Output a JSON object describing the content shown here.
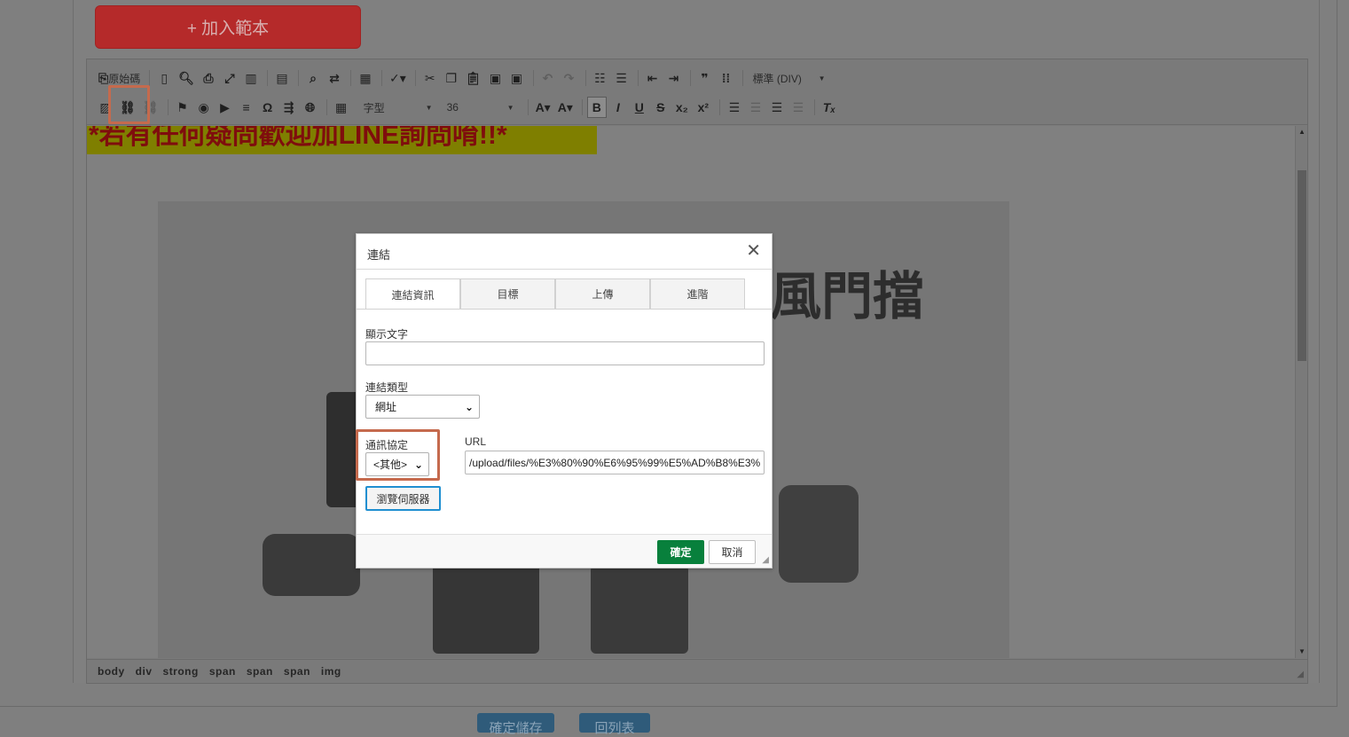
{
  "page": {
    "add_template_label": "+ 加入範本",
    "save_label": "確定儲存",
    "back_label": "回列表"
  },
  "toolbar": {
    "source_label": "原始碼",
    "format_combo": "標準 (DIV)",
    "font_combo": "字型",
    "size_combo": "36"
  },
  "content": {
    "promo_text": "*若有任何疑問歡迎加LINE詢問唷!!*",
    "image_title": "風門擋"
  },
  "path_bar": [
    "body",
    "div",
    "strong",
    "span",
    "span",
    "span",
    "img"
  ],
  "dialog": {
    "title": "連結",
    "tabs": [
      "連結資訊",
      "目標",
      "上傳",
      "進階"
    ],
    "display_text_label": "顯示文字",
    "display_text_value": "",
    "link_type_label": "連結類型",
    "link_type_value": "網址",
    "protocol_label": "通訊協定",
    "protocol_value": "<其他>",
    "url_label": "URL",
    "url_value": "/upload/files/%E3%80%90%E6%95%99%E5%AD%B8%E3%",
    "browse_label": "瀏覽伺服器",
    "ok_label": "確定",
    "cancel_label": "取消"
  },
  "colors": {
    "overlay_gray": "#7f7f7f",
    "ok_green": "#08803c",
    "highlight": "#c56a4d",
    "focus_blue": "#1f8fd1"
  }
}
